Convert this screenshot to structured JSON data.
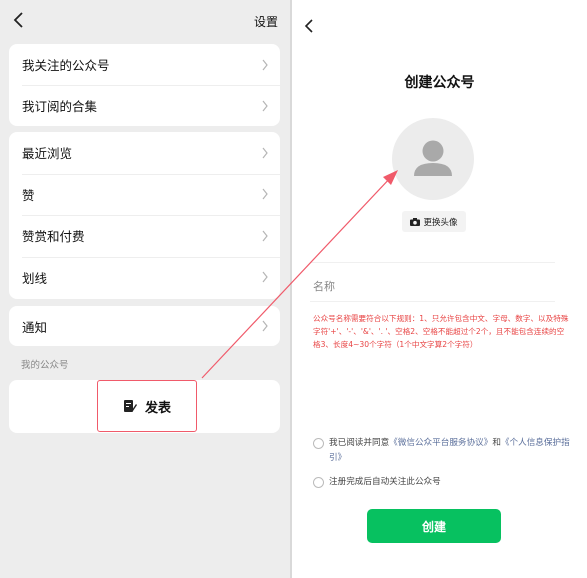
{
  "left": {
    "settings_label": "设置",
    "group1": [
      "我关注的公众号",
      "我订阅的合集"
    ],
    "group2": [
      "最近浏览",
      "赞",
      "赞赏和付费",
      "划线"
    ],
    "group3": [
      "通知"
    ],
    "section_label": "我的公众号",
    "publish_label": "发表"
  },
  "right": {
    "title": "创建公众号",
    "change_avatar_label": "更换头像",
    "name_label": "名称",
    "rules_text": "公众号名称需要符合以下规则：1、只允许包含中文、字母、数字、以及特殊字符'+'、'-'、'&'、'. '、空格2、空格不能超过个2个，且不能包含连续的空格3、长度4~30个字符（1个中文字算2个字符）",
    "agree_prefix": "我已阅读并同意",
    "agree_link1": "《微信公众平台服务协议》",
    "agree_and": "和",
    "agree_link2": "《个人信息保护指引》",
    "auto_follow": "注册完成后自动关注此公众号",
    "create_button": "创建"
  },
  "colors": {
    "accent_green": "#07c160",
    "rules_red": "#e84444",
    "highlight_pink": "#f05a6a",
    "link_blue": "#5b6f9b"
  }
}
